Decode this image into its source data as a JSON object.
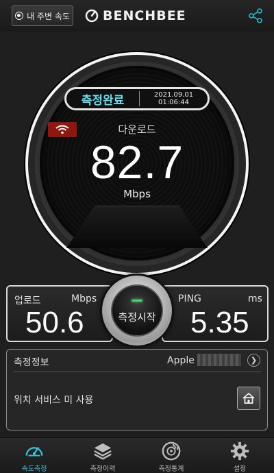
{
  "header": {
    "nearby_label": "내 주변 속도",
    "brand_name": "BENCHBEE"
  },
  "gauge": {
    "status": "측정완료",
    "timestamp": "2021.09.01 01:06:44",
    "download_label": "다운로드",
    "download_value": "82.7",
    "download_unit": "Mbps"
  },
  "upload": {
    "label": "업로드",
    "unit": "Mbps",
    "value": "50.6"
  },
  "ping": {
    "label": "PING",
    "unit": "ms",
    "value": "5.35"
  },
  "start_button": {
    "label": "측정시작"
  },
  "info": {
    "title": "측정정보",
    "isp": "Apple",
    "location_text": "위치 서비스 미 사용"
  },
  "tabs": [
    {
      "label": "속도측정",
      "icon": "speedometer-icon",
      "active": true
    },
    {
      "label": "측정이력",
      "icon": "layers-icon",
      "active": false
    },
    {
      "label": "측정통계",
      "icon": "chart-disc-icon",
      "active": false
    },
    {
      "label": "설정",
      "icon": "gear-icon",
      "active": false
    }
  ],
  "colors": {
    "accent": "#35c2d6",
    "status_text": "#5fe0ee",
    "wifi_badge": "#8e1810",
    "led": "#4bd86a"
  }
}
